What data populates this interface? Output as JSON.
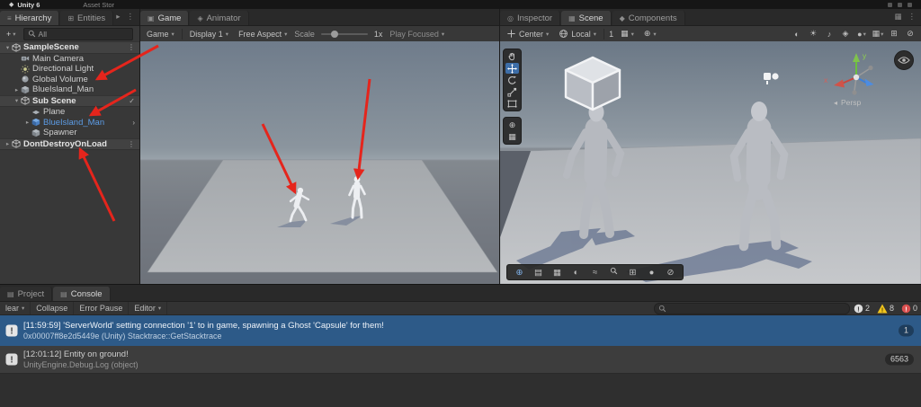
{
  "icons": {
    "logo": "◆",
    "menu": "≡",
    "window": "⊞",
    "box": "▣",
    "gem": "◈",
    "target": "◎",
    "grid": "▦",
    "diamond": "◆",
    "rows": "▤",
    "caret": "▾",
    "chev": "▸",
    "kebab": "⋮",
    "check": "✓",
    "plus": "+",
    "chev2": "›",
    "sphere": "◐",
    "sun": "☀",
    "note": "♪",
    "dot": "●",
    "plus_circle": "⊕",
    "slash": "⊘",
    "wave": "≈",
    "persp": "◂"
  },
  "menubar": {
    "app_title": "Unity 6",
    "asset_store": "Asset Stor"
  },
  "hierarchy": {
    "tabs": [
      {
        "label": "Hierarchy"
      },
      {
        "label": "Entities"
      }
    ],
    "search_value": "All",
    "items": [
      {
        "label": "SampleScene"
      },
      {
        "label": "Main Camera"
      },
      {
        "label": "Directional Light"
      },
      {
        "label": "Global Volume"
      },
      {
        "label": "BlueIsland_Man"
      },
      {
        "label": "Sub Scene"
      },
      {
        "label": "Plane"
      },
      {
        "label": "BlueIsland_Man"
      },
      {
        "label": "Spawner"
      },
      {
        "label": "DontDestroyOnLoad"
      }
    ]
  },
  "game": {
    "tabs": [
      {
        "label": "Game"
      },
      {
        "label": "Animator"
      }
    ],
    "toolbar": {
      "game": "Game",
      "display": "Display 1",
      "aspect": "Free Aspect",
      "scale_label": "Scale",
      "scale_value": "1x",
      "play_focused": "Play Focused"
    }
  },
  "scene": {
    "tabs": [
      {
        "label": "Inspector"
      },
      {
        "label": "Scene"
      },
      {
        "label": "Components"
      }
    ],
    "toolbar": {
      "center": "Center",
      "local": "Local",
      "grid_value": "1"
    },
    "viewport": {
      "persp": "Persp",
      "axis_x": "x",
      "axis_y": "y"
    }
  },
  "console": {
    "tabs": [
      {
        "label": "Project"
      },
      {
        "label": "Console"
      }
    ],
    "toolbar": {
      "clear": "lear",
      "collapse": "Collapse",
      "error_pause": "Error Pause",
      "editor": "Editor",
      "info_count": "2",
      "warning_count": "8",
      "error_count": "0"
    },
    "entries": [
      {
        "message": "[11:59:59] 'ServerWorld' setting connection '1' to in game, spawning a Ghost 'Capsule' for them!",
        "detail": "0x00007ff8e2d5449e (Unity) Stacktrace::GetStacktrace",
        "count": "1"
      },
      {
        "message": "[12:01:12] Entity on ground!",
        "detail": "UnityEngine.Debug.Log (object)",
        "count": "6563"
      }
    ]
  }
}
